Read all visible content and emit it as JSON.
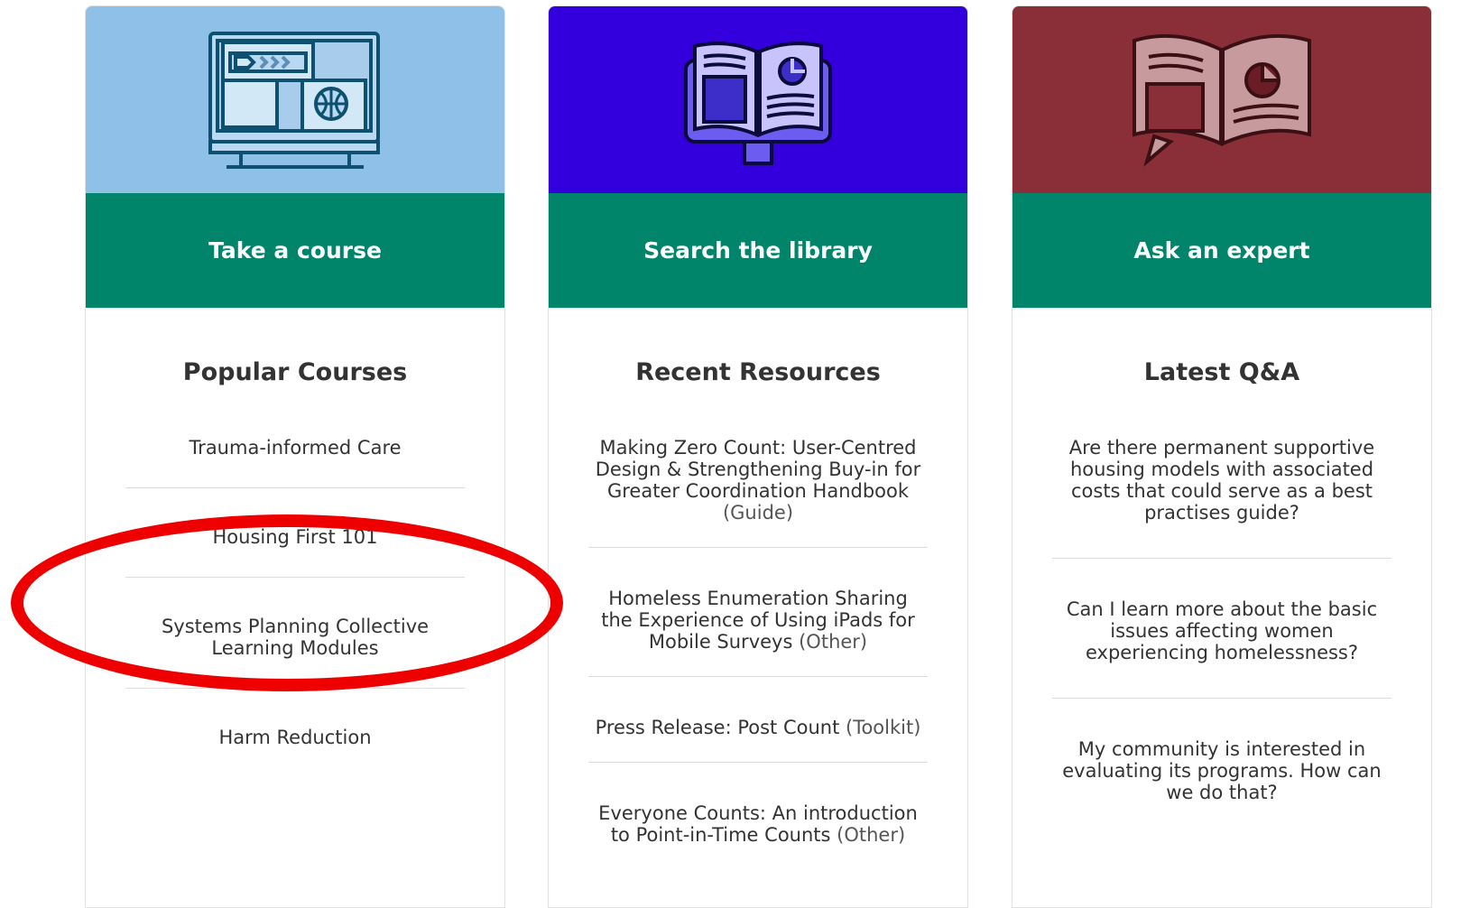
{
  "colors": {
    "course_bg": "#8fc0e8",
    "library_bg": "#3300dd",
    "expert_bg": "#8a2f38",
    "banner": "#00856b",
    "highlight": "#ee0000"
  },
  "cards": [
    {
      "banner": "Take a course",
      "icon": "computer-screen-icon",
      "title": "Popular Courses",
      "items": [
        {
          "text": "Trauma-informed Care",
          "tag": ""
        },
        {
          "text": "Housing First 101",
          "tag": ""
        },
        {
          "text": "Systems Planning Collective Learning Modules",
          "tag": ""
        },
        {
          "text": "Harm Reduction",
          "tag": ""
        }
      ]
    },
    {
      "banner": "Search the library",
      "icon": "book-on-monitor-icon",
      "title": "Recent Resources",
      "items": [
        {
          "text": "Making Zero Count: User-Centred Design & Strengthening Buy-in for Greater Coordination Handbook",
          "tag": "(Guide)"
        },
        {
          "text": "Homeless Enumeration Sharing the Experience of Using iPads for Mobile Surveys",
          "tag": "(Other)"
        },
        {
          "text": "Press Release: Post Count",
          "tag": "(Toolkit)"
        },
        {
          "text": "Everyone Counts: An introduction to Point-in-Time Counts",
          "tag": "(Other)"
        }
      ]
    },
    {
      "banner": "Ask an expert",
      "icon": "open-book-speech-icon",
      "title": "Latest Q&A",
      "items": [
        {
          "text": "Are there permanent supportive housing models with associated costs that could serve as a best practises guide?",
          "tag": ""
        },
        {
          "text": "Can I learn more about the basic issues affecting women experiencing homelessness?",
          "tag": ""
        },
        {
          "text": "My community is interested in evaluating its programs. How can we do that?",
          "tag": ""
        }
      ]
    }
  ]
}
